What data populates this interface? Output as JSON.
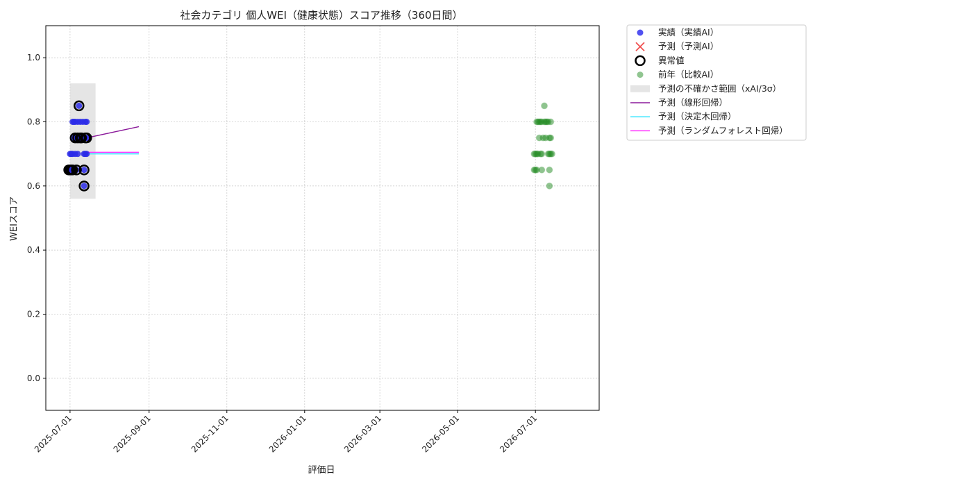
{
  "chart_data": {
    "type": "scatter",
    "title": "社会カテゴリ 個人WEI（健康状態）スコア推移（360日間）",
    "xlabel": "評価日",
    "ylabel": "WEIスコア",
    "xlim": [
      "2025-06-12",
      "2026-08-20"
    ],
    "ylim": [
      -0.1,
      1.1
    ],
    "yticks": [
      0.0,
      0.2,
      0.4,
      0.6,
      0.8,
      1.0
    ],
    "ytick_labels": [
      "0.0",
      "0.2",
      "0.4",
      "0.6",
      "0.8",
      "1.0"
    ],
    "xticks": [
      "2025-07-01",
      "2025-09-01",
      "2025-11-01",
      "2026-01-01",
      "2026-03-01",
      "2026-05-01",
      "2026-07-01"
    ],
    "grid": true,
    "legend_position": "outside-right",
    "legend": [
      {
        "label": "実績（実績AI）",
        "kind": "dot",
        "color": "#3333ee"
      },
      {
        "label": "予測（予測AI）",
        "kind": "x",
        "color": "#ee3333"
      },
      {
        "label": "異常値",
        "kind": "ring",
        "color": "#000000"
      },
      {
        "label": "前年（比較AI）",
        "kind": "dot-faint",
        "color": "#228b22"
      },
      {
        "label": "予測の不確かさ範囲（xAI/3σ）",
        "kind": "patch",
        "color": "#d3d3d3"
      },
      {
        "label": "予測（線形回帰）",
        "kind": "line",
        "color": "#8b1a9b"
      },
      {
        "label": "予測（決定木回帰）",
        "kind": "line",
        "color": "#33e5ff"
      },
      {
        "label": "予測（ランダムフォレスト回帰）",
        "kind": "line",
        "color": "#ff33ff"
      }
    ],
    "uncertainty_band": {
      "x_start": "2025-07-01",
      "x_end": "2025-07-21",
      "y_low": 0.56,
      "y_high": 0.92
    },
    "actual_points": [
      {
        "x": "2025-06-30",
        "y": 0.65
      },
      {
        "x": "2025-07-01",
        "y": 0.7
      },
      {
        "x": "2025-07-01",
        "y": 0.65
      },
      {
        "x": "2025-07-02",
        "y": 0.65
      },
      {
        "x": "2025-07-02",
        "y": 0.7
      },
      {
        "x": "2025-07-03",
        "y": 0.8
      },
      {
        "x": "2025-07-03",
        "y": 0.65
      },
      {
        "x": "2025-07-03",
        "y": 0.7
      },
      {
        "x": "2025-07-04",
        "y": 0.65
      },
      {
        "x": "2025-07-04",
        "y": 0.8
      },
      {
        "x": "2025-07-04",
        "y": 0.75
      },
      {
        "x": "2025-07-05",
        "y": 0.7
      },
      {
        "x": "2025-07-05",
        "y": 0.8
      },
      {
        "x": "2025-07-06",
        "y": 0.75
      },
      {
        "x": "2025-07-06",
        "y": 0.65
      },
      {
        "x": "2025-07-07",
        "y": 0.7
      },
      {
        "x": "2025-07-07",
        "y": 0.8
      },
      {
        "x": "2025-07-08",
        "y": 0.85
      },
      {
        "x": "2025-07-08",
        "y": 0.75
      },
      {
        "x": "2025-07-09",
        "y": 0.8
      },
      {
        "x": "2025-07-09",
        "y": 0.75
      },
      {
        "x": "2025-07-10",
        "y": 0.75
      },
      {
        "x": "2025-07-11",
        "y": 0.8
      },
      {
        "x": "2025-07-12",
        "y": 0.7
      },
      {
        "x": "2025-07-12",
        "y": 0.65
      },
      {
        "x": "2025-07-12",
        "y": 0.6
      },
      {
        "x": "2025-07-13",
        "y": 0.75
      },
      {
        "x": "2025-07-13",
        "y": 0.8
      },
      {
        "x": "2025-07-13",
        "y": 0.7
      },
      {
        "x": "2025-07-14",
        "y": 0.75
      },
      {
        "x": "2025-07-14",
        "y": 0.7
      },
      {
        "x": "2025-07-14",
        "y": 0.8
      }
    ],
    "anomaly_points": [
      {
        "x": "2025-06-30",
        "y": 0.65
      },
      {
        "x": "2025-07-01",
        "y": 0.65
      },
      {
        "x": "2025-07-02",
        "y": 0.65
      },
      {
        "x": "2025-07-03",
        "y": 0.65
      },
      {
        "x": "2025-07-06",
        "y": 0.65
      },
      {
        "x": "2025-07-05",
        "y": 0.75
      },
      {
        "x": "2025-07-07",
        "y": 0.75
      },
      {
        "x": "2025-07-08",
        "y": 0.85
      },
      {
        "x": "2025-07-09",
        "y": 0.75
      },
      {
        "x": "2025-07-10",
        "y": 0.75
      },
      {
        "x": "2025-07-12",
        "y": 0.65
      },
      {
        "x": "2025-07-12",
        "y": 0.6
      },
      {
        "x": "2025-07-13",
        "y": 0.75
      },
      {
        "x": "2025-07-14",
        "y": 0.75
      }
    ],
    "previous_year_points": [
      {
        "x": "2026-06-30",
        "y": 0.7
      },
      {
        "x": "2026-06-30",
        "y": 0.65
      },
      {
        "x": "2026-07-01",
        "y": 0.7
      },
      {
        "x": "2026-07-01",
        "y": 0.65
      },
      {
        "x": "2026-07-02",
        "y": 0.65
      },
      {
        "x": "2026-07-02",
        "y": 0.7
      },
      {
        "x": "2026-07-02",
        "y": 0.8
      },
      {
        "x": "2026-07-03",
        "y": 0.8
      },
      {
        "x": "2026-07-03",
        "y": 0.7
      },
      {
        "x": "2026-07-04",
        "y": 0.75
      },
      {
        "x": "2026-07-04",
        "y": 0.8
      },
      {
        "x": "2026-07-05",
        "y": 0.7
      },
      {
        "x": "2026-07-05",
        "y": 0.8
      },
      {
        "x": "2026-07-06",
        "y": 0.65
      },
      {
        "x": "2026-07-06",
        "y": 0.7
      },
      {
        "x": "2026-07-06",
        "y": 0.8
      },
      {
        "x": "2026-07-07",
        "y": 0.75
      },
      {
        "x": "2026-07-08",
        "y": 0.85
      },
      {
        "x": "2026-07-08",
        "y": 0.8
      },
      {
        "x": "2026-07-09",
        "y": 0.75
      },
      {
        "x": "2026-07-09",
        "y": 0.8
      },
      {
        "x": "2026-07-10",
        "y": 0.8
      },
      {
        "x": "2026-07-11",
        "y": 0.7
      },
      {
        "x": "2026-07-11",
        "y": 0.8
      },
      {
        "x": "2026-07-12",
        "y": 0.7
      },
      {
        "x": "2026-07-12",
        "y": 0.75
      },
      {
        "x": "2026-07-12",
        "y": 0.65
      },
      {
        "x": "2026-07-12",
        "y": 0.6
      },
      {
        "x": "2026-07-13",
        "y": 0.8
      },
      {
        "x": "2026-07-13",
        "y": 0.7
      },
      {
        "x": "2026-07-13",
        "y": 0.75
      },
      {
        "x": "2026-07-14",
        "y": 0.7
      }
    ],
    "forecast_lines": [
      {
        "name": "予測（線形回帰）",
        "color": "#8b1a9b",
        "x": [
          "2025-07-14",
          "2025-08-24"
        ],
        "y": [
          0.75,
          0.785
        ]
      },
      {
        "name": "予測（決定木回帰）",
        "color": "#33e5ff",
        "x": [
          "2025-07-14",
          "2025-08-24"
        ],
        "y": [
          0.7,
          0.7
        ]
      },
      {
        "name": "予測（ランダムフォレスト回帰）",
        "color": "#ff33ff",
        "x": [
          "2025-07-14",
          "2025-08-24"
        ],
        "y": [
          0.705,
          0.705
        ]
      }
    ],
    "colors": {
      "actual": "#2a2ae8",
      "anomaly": "#000000",
      "previous_year": "#228b22",
      "band": "#d3d3d3",
      "grid": "#cccccc"
    }
  }
}
